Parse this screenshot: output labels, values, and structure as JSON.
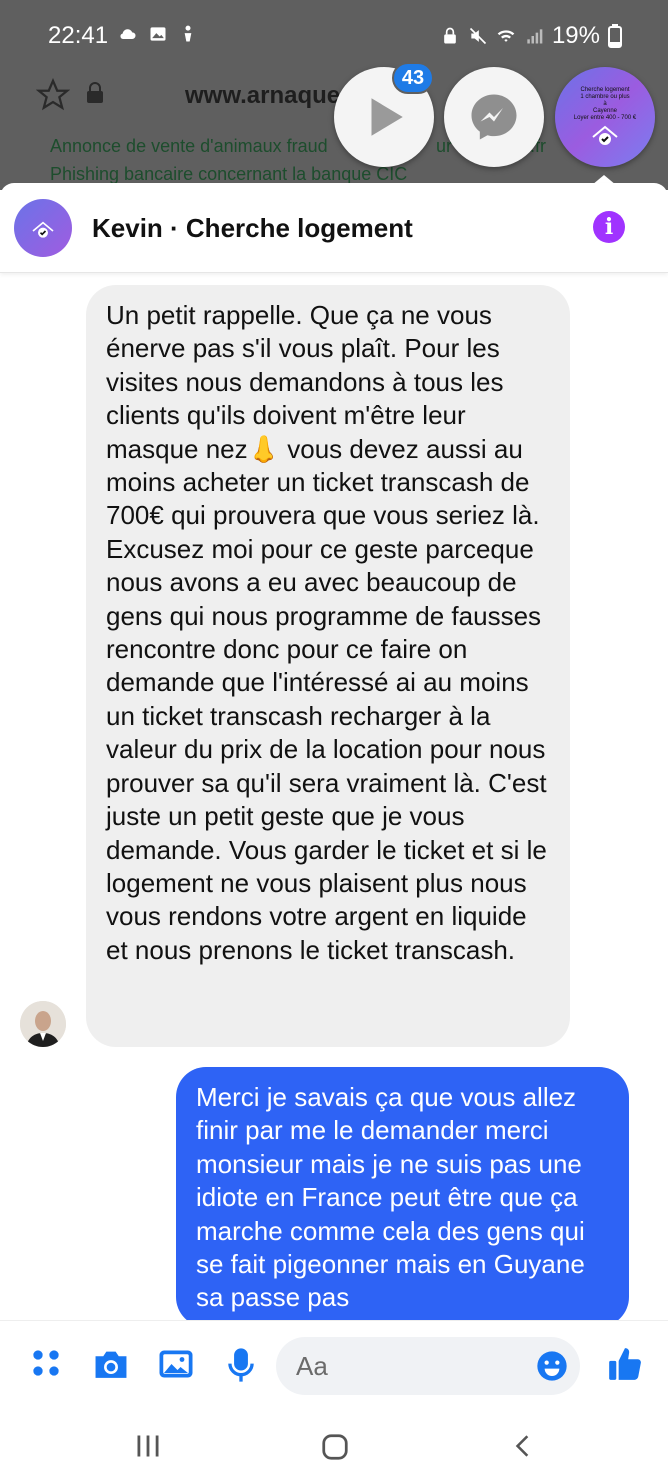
{
  "status_bar": {
    "time": "22:41",
    "battery": "19%"
  },
  "browser": {
    "url_visible": "www.arnaque",
    "url_tail": "ne",
    "links": [
      "Annonce de vente d'animaux fraud",
      "ur L",
      ".fr",
      "Phishing bancaire concernant la banque CIC"
    ]
  },
  "chat_heads": {
    "badge_count": "43",
    "profile_lines": [
      "Cherche logement",
      "1 chambre ou plus",
      "à",
      "Cayenne",
      "Loyer entre 400 - 700 €"
    ]
  },
  "header": {
    "title": "Kevin · Cherche logement"
  },
  "messages": {
    "incoming": "Un petit rappelle. Que ça ne vous énerve pas s'il vous plaît. Pour les visites nous demandons à tous les clients qu'ils doivent m'être leur masque nez👃 vous devez aussi au moins acheter un ticket transcash de 700€ qui prouvera que vous seriez là. Excusez moi pour ce geste parceque nous avons a eu avec beaucoup de gens qui nous programme de fausses rencontre donc pour ce faire on demande que l'intéressé ai au moins un ticket transcash recharger à la valeur du prix de la location pour nous prouver sa qu'il sera vraiment là. C'est juste un petit geste que je vous demande. Vous garder le ticket et si le logement ne vous plaisent plus nous vous rendons votre argent en liquide et nous prenons le ticket transcash.",
    "outgoing": "Merci je savais ça que vous allez finir par me le demander merci monsieur mais je ne suis pas une idiote en France peut être que ça marche comme cela des gens qui se fait pigeonner mais en Guyane sa passe pas"
  },
  "composer": {
    "placeholder": "Aa"
  },
  "colors": {
    "messenger_blue": "#2e63f5",
    "accent_blue": "#1f7be6",
    "info_purple": "#a033ff"
  }
}
